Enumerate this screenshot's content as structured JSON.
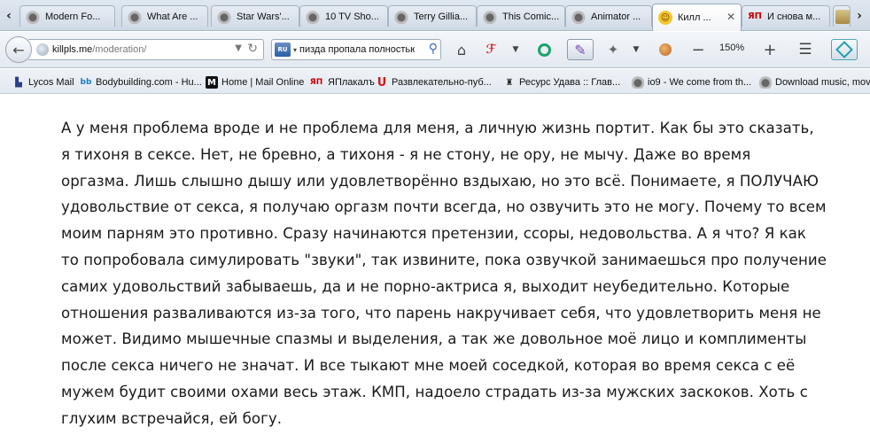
{
  "tabs": [
    {
      "label": "Modern Fo...",
      "icon": "dog-icon"
    },
    {
      "label": "What Are ...",
      "icon": "dog-icon"
    },
    {
      "label": "Star Wars'...",
      "icon": "dog-icon"
    },
    {
      "label": "10 TV Sho...",
      "icon": "dog-icon"
    },
    {
      "label": "Terry Gillia...",
      "icon": "dog-icon"
    },
    {
      "label": "This Comic...",
      "icon": "dog-icon"
    },
    {
      "label": "Animator ...",
      "icon": "dog-icon"
    },
    {
      "label": "Килл ...",
      "icon": "smiley-icon",
      "active": true
    },
    {
      "label": "И снова м...",
      "icon": "yap-icon"
    }
  ],
  "tab_icons": {
    "yap": "ЯП",
    "smile": "☺",
    "close": "✕",
    "scroll_left": "‹",
    "scroll_right": "›"
  },
  "nav": {
    "back": "←",
    "url_host": "killpls.me",
    "url_path": "/moderation/",
    "search_query": "пизда пропала полностью",
    "search_engine": "RU",
    "zoom": "150%"
  },
  "bookmarks": [
    {
      "label": "Lycos Mail",
      "icon": "lycos-icon"
    },
    {
      "label": "Bodybuilding.com - Hu...",
      "icon": "bodybuilding-icon"
    },
    {
      "label": "Home | Mail Online",
      "icon": "mailonline-icon"
    },
    {
      "label": "ЯПлакалъ",
      "icon": "yap-icon"
    },
    {
      "label": "Развлекательно-пуб...",
      "icon": "u-icon"
    },
    {
      "label": "Ресурс Удава :: Глав...",
      "icon": "udav-icon"
    },
    {
      "label": "io9 - We come from th...",
      "icon": "dog-icon"
    },
    {
      "label": "Download music, movi",
      "icon": "dog-icon"
    }
  ],
  "bookmark_icon_text": {
    "bodybuilding": "bb",
    "mailonline": "M",
    "yap": "ЯП",
    "u": "U"
  },
  "story": "А у меня проблема вроде и не проблема для меня, а личную жизнь портит. Как бы это сказать,\nя тихоня в сексе. Нет, не бревно, а тихоня - я не стону, не ору, не мычу. Даже во время\nоргазма. Лишь слышно дышу или удовлетворённо вздыхаю, но это всё. Понимаете, я ПОЛУЧАЮ\nудовольствие от секса, я получаю оргазм почти всегда, но озвучить это не могу. Почему то всем\nмоим парням это противно. Сразу начинаются претензии, ссоры, недовольства. А я что? Я как\nто попробовала симулировать \"звуки\", так извините, пока озвучкой занимаешься про получение\nсамих удовольствий забываешь, да и не порно-актриса я, выходит неубедительно. Которые\nотношения разваливаются из-за того, что парень накручивает себя, что удовлетворить меня не\nможет. Видимо мышечные спазмы и выделения, а так же довольное моё лицо и комплименты\nпосле секса ничего не значат. И все тыкают мне моей соседкой, которая во время секса с её\nмужем будит своими охами весь этаж. КМП, надоело страдать из-за мужских заскоков. Хоть с\nглухим встречайся, ей богу."
}
